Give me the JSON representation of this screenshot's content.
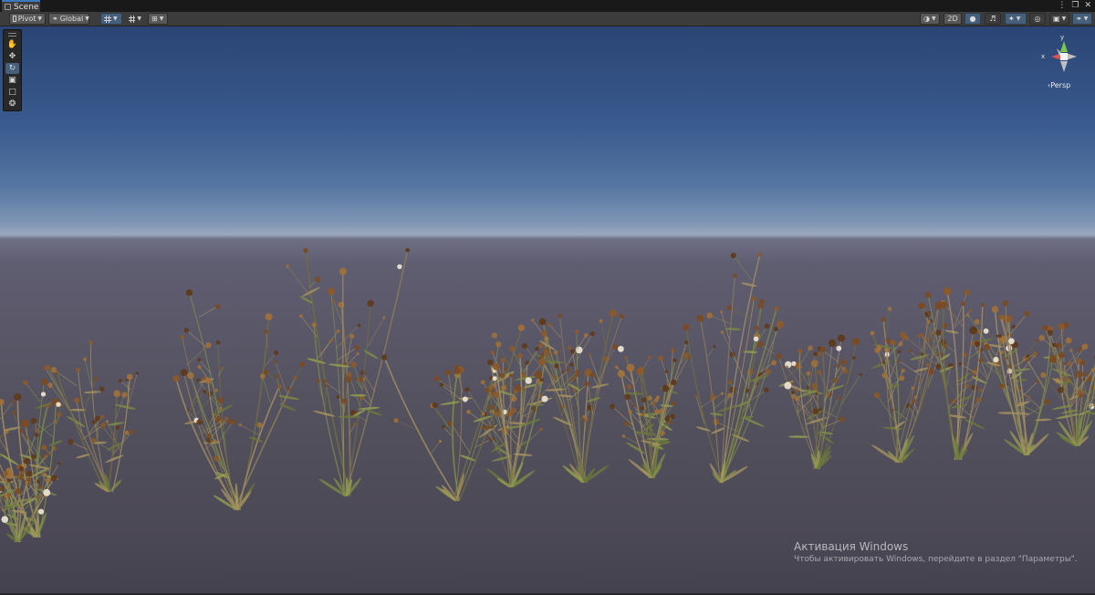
{
  "window": {
    "tab_label": "Scene",
    "tab_icon": "scene-grid-icon",
    "controls": [
      "more-icon",
      "maximize-icon",
      "close-icon"
    ]
  },
  "toolbar": {
    "pivot_label": "Pivot",
    "global_label": "Global",
    "twod_label": "2D",
    "left_buttons": [
      "pivot-toggle",
      "global-toggle",
      "grid-visibility",
      "grid-snapping",
      "increment-snap"
    ],
    "right_buttons": [
      "draw-mode",
      "2d-toggle",
      "lighting-toggle",
      "audio-toggle",
      "effects-toggle",
      "hidden-objects-toggle",
      "camera-settings",
      "gizmos-toggle"
    ]
  },
  "tools": [
    "hand-tool",
    "move-tool",
    "rotate-tool",
    "scale-tool",
    "rect-tool",
    "transform-tool"
  ],
  "active_tool": "rotate-tool",
  "gizmo": {
    "x_label": "x",
    "y_label": "y",
    "projection_label": "Persp"
  },
  "watermark": {
    "title": "Активация Windows",
    "subtitle": "Чтобы активировать Windows, перейдите в раздел \"Параметры\"."
  },
  "colors": {
    "sky_top": "#2a4574",
    "horizon": "#9ba8bd",
    "ground": "#4b4855",
    "accent": "#46607c",
    "x_axis": "#d9534f",
    "y_axis": "#7ac943"
  }
}
